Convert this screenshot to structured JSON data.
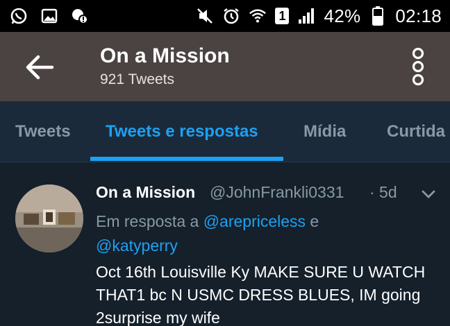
{
  "status_bar": {
    "icons_left": [
      "whatsapp-icon",
      "gallery-icon",
      "app-notification-icon"
    ],
    "icons_right": [
      "mute-icon",
      "alarm-icon",
      "wifi-icon",
      "sim-icon",
      "signal-icon",
      "battery-icon"
    ],
    "sim_label": "1",
    "battery": "42%",
    "time": "02:18"
  },
  "header": {
    "title": "On a Mission",
    "subtitle": "921 Tweets"
  },
  "tabs": [
    {
      "label": "Tweets",
      "active": false
    },
    {
      "label": "Tweets e respostas",
      "active": true
    },
    {
      "label": "Mídia",
      "active": false
    },
    {
      "label": "Curtida",
      "active": false
    }
  ],
  "tweet": {
    "name": "On a Mission",
    "handle": "@JohnFrankli0331",
    "time": "· 5d",
    "reply_prefix": "Em resposta a ",
    "reply_user1": "@arepriceless",
    "reply_join": " e",
    "reply_user2": "@katyperry",
    "text": "Oct 16th Louisville Ky MAKE SURE U WATCH THAT1 bc N USMC DRESS BLUES, IM going 2surprise my wife"
  },
  "colors": {
    "accent": "#1da1f2",
    "header_bg": "#4a4341",
    "tabs_bg": "#1b2a3a",
    "body_bg": "#15202b"
  }
}
